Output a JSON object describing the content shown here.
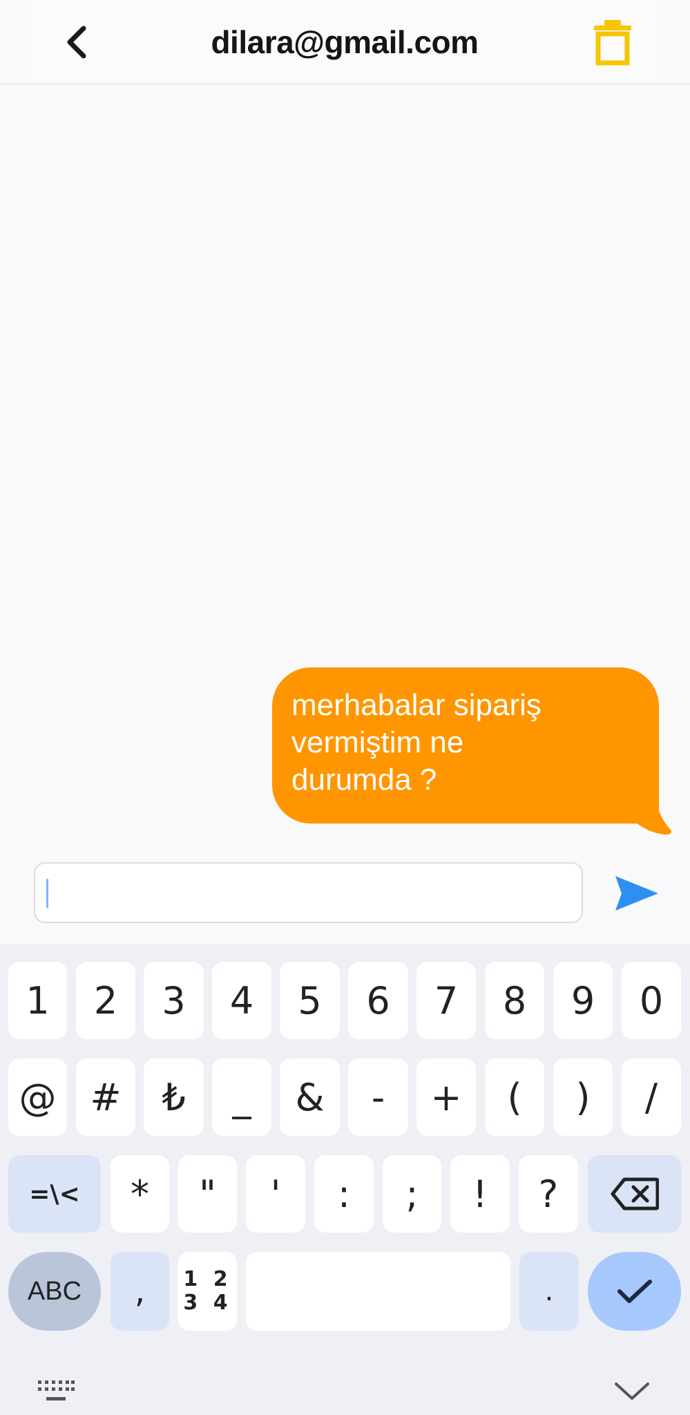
{
  "header": {
    "title": "dilara@gmail.com",
    "back_icon": "chevron-left-icon",
    "trash_icon": "trash-icon",
    "accent_color": "#f7c600"
  },
  "conversation": {
    "messages": [
      {
        "line1": "merhabalar sipariş",
        "line2": "vermiştim ne",
        "line3": "durumda ?",
        "color": "#ff9500"
      }
    ]
  },
  "composer": {
    "value": "",
    "send_icon": "send-icon",
    "send_color": "#2f8ff0"
  },
  "keyboard": {
    "row1": [
      "1",
      "2",
      "3",
      "4",
      "5",
      "6",
      "7",
      "8",
      "9",
      "0"
    ],
    "row2": [
      "@",
      "#",
      "₺",
      "_",
      "&",
      "-",
      "+",
      "(",
      ")",
      "/"
    ],
    "row3": [
      "=\\<",
      "*",
      "\"",
      "'",
      ":",
      ";",
      "!",
      "?"
    ],
    "row4": {
      "abc": "ABC",
      "comma": ",",
      "numpad_top": "1 2",
      "numpad_bottom": "3 4",
      "period": "."
    },
    "backspace_icon": "backspace-icon",
    "done_icon": "checkmark-icon",
    "keyboard_icon": "keyboard-icon",
    "hide_icon": "chevron-down-icon"
  }
}
